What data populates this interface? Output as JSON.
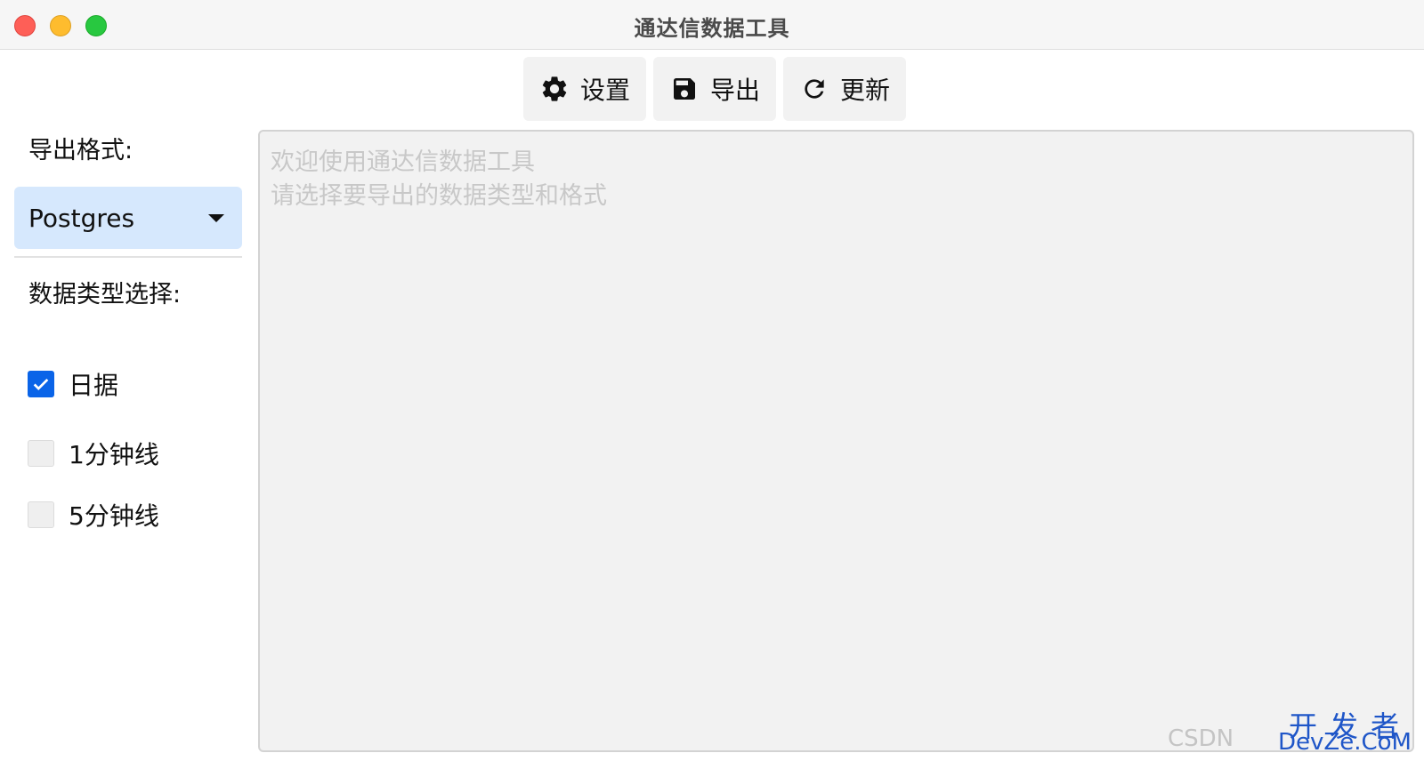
{
  "window": {
    "title": "通达信数据工具",
    "controls": [
      "close",
      "minimize",
      "zoom"
    ]
  },
  "toolbar": {
    "buttons": [
      {
        "icon": "gear-icon",
        "label": "设置"
      },
      {
        "icon": "save-icon",
        "label": "导出"
      },
      {
        "icon": "refresh-icon",
        "label": "更新"
      }
    ]
  },
  "sidebar": {
    "format_label": "导出格式:",
    "format_value": "Postgres",
    "types_label": "数据类型选择:",
    "types": [
      {
        "label": "日据",
        "checked": true
      },
      {
        "label": "1分钟线",
        "checked": false
      },
      {
        "label": "5分钟线",
        "checked": false
      }
    ]
  },
  "log": {
    "lines": [
      "欢迎使用通达信数据工具",
      "请选择要导出的数据类型和格式"
    ]
  },
  "watermark": {
    "csdn": "CSDN",
    "cn": "开发者",
    "en": "DevZe.CoM"
  },
  "colors": {
    "accent": "#0a64e8",
    "select_bg": "#d6e8fd",
    "log_bg": "#f2f2f2",
    "watermark": "#1f56c8"
  }
}
